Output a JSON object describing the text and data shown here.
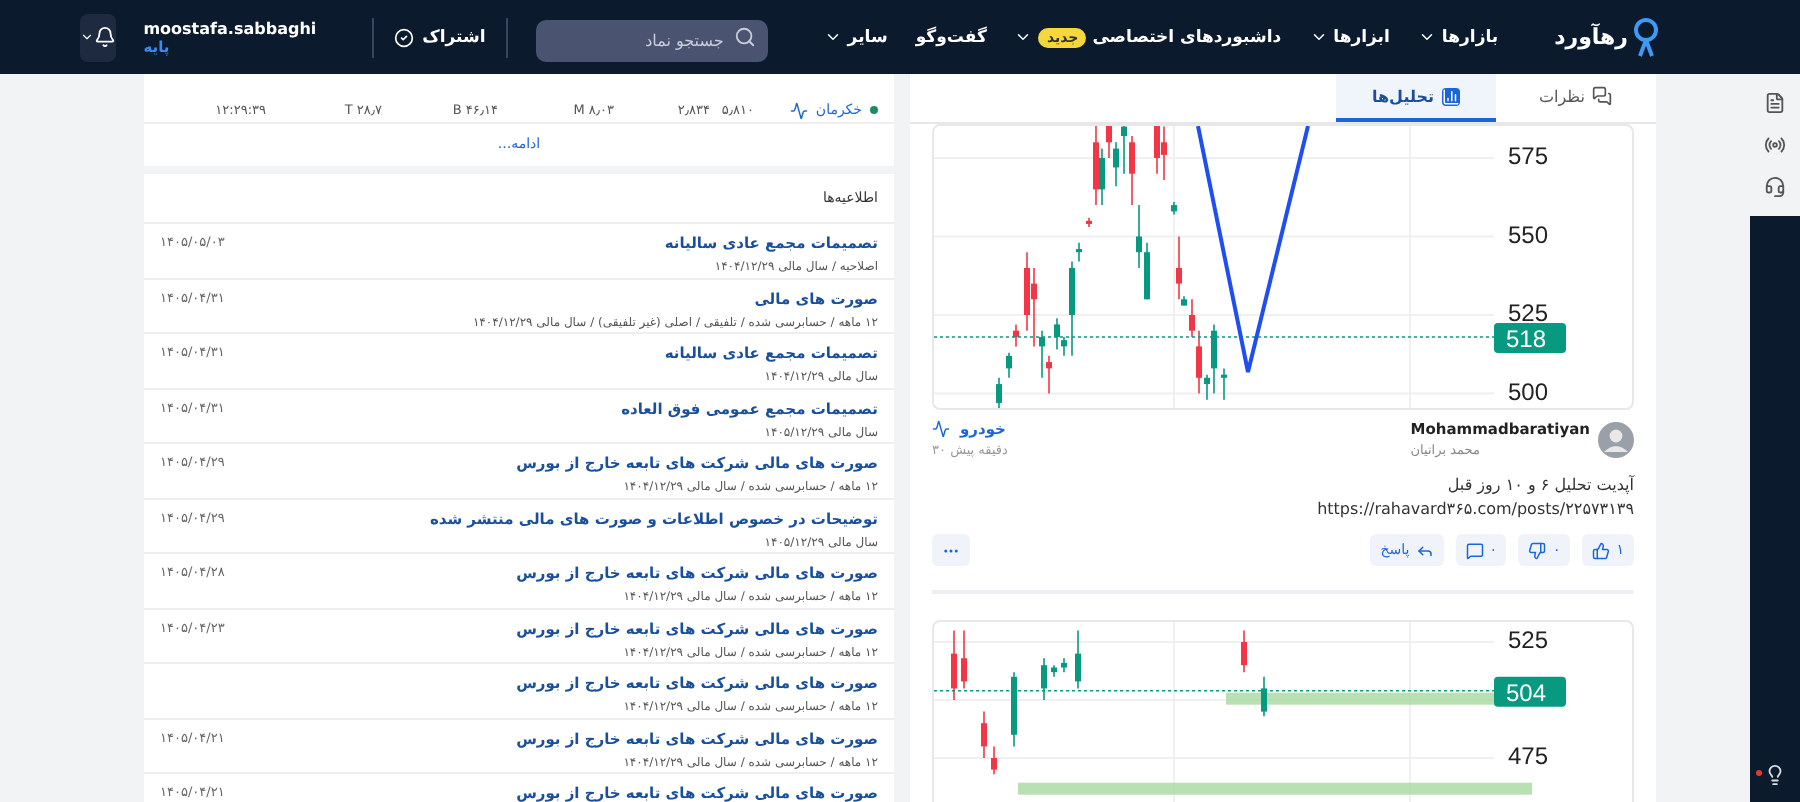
{
  "nav": {
    "logo": "رهآورد",
    "menu": [
      {
        "label": "بازارها",
        "dropdown": true
      },
      {
        "label": "ابزارها",
        "dropdown": true
      },
      {
        "label": "داشبوردهای اختصاصی",
        "badge": "جدید",
        "dropdown": true
      },
      {
        "label": "گفت‌وگو",
        "dropdown": false
      },
      {
        "label": "سایر",
        "dropdown": true
      }
    ],
    "search": {
      "placeholder": "جستجو نماد"
    },
    "subscription": "اشتراک",
    "user": {
      "name": "moostafa.sabbaghi",
      "plan": "پایه"
    }
  },
  "market_row": {
    "symbol": "خکرمان",
    "cells": [
      "۵٫۸۱۰",
      "۲٫۸۳۴",
      "۸٫۰۳ M",
      "۴۶٫۱۴ B",
      "۲۸٫۷ T",
      "۱۲:۲۹:۳۹"
    ]
  },
  "more_link": "ادامه...",
  "announcements": {
    "title": "اطلاعیه‌ها",
    "items": [
      {
        "title": "تصمیمات مجمع عادی سالیانه",
        "details": "اصلاحیه / سال مالی ۱۴۰۴/۱۲/۲۹",
        "date": "۱۴۰۵/۰۵/۰۳"
      },
      {
        "title": "صورت های مالی",
        "details": "۱۲ ماهه / حسابرسی شده / تلفیقی / اصلی (غیر تلفیقی) / سال مالی ۱۴۰۴/۱۲/۲۹",
        "date": "۱۴۰۵/۰۴/۳۱"
      },
      {
        "title": "تصمیمات مجمع عادی سالیانه",
        "details": "سال مالی ۱۴۰۴/۱۲/۲۹",
        "date": "۱۴۰۵/۰۴/۳۱"
      },
      {
        "title": "تصمیمات مجمع عمومی فوق العاده",
        "details": "سال مالی ۱۴۰۵/۱۲/۲۹",
        "date": "۱۴۰۵/۰۴/۳۱"
      },
      {
        "title": "صورت های مالی شرکت های تابعه خارج از بورس",
        "details": "۱۲ ماهه / حسابرسی شده / سال مالی ۱۴۰۴/۱۲/۲۹",
        "date": "۱۴۰۵/۰۴/۲۹"
      },
      {
        "title": "توضیحات در خصوص اطلاعات و صورت های مالی منتشر شده",
        "details": "سال مالی ۱۴۰۵/۱۲/۲۹",
        "date": "۱۴۰۵/۰۴/۲۹"
      },
      {
        "title": "صورت های مالی شرکت های تابعه خارج از بورس",
        "details": "۱۲ ماهه / حسابرسی شده / سال مالی ۱۴۰۴/۱۲/۲۹",
        "date": "۱۴۰۵/۰۴/۲۸"
      },
      {
        "title": "صورت های مالی شرکت های تابعه خارج از بورس",
        "details": "۱۲ ماهه / حسابرسی شده / سال مالی ۱۴۰۴/۱۲/۲۹",
        "date": "۱۴۰۵/۰۴/۲۳"
      },
      {
        "title": "صورت های مالی شرکت های تابعه خارج از بورس",
        "details": "۱۲ ماهه / حسابرسی شده / سال مالی ۱۴۰۴/۱۲/۲۹"
      },
      {
        "title": "صورت های مالی شرکت های تابعه خارج از بورس",
        "details": "۱۲ ماهه / حسابرسی شده / سال مالی ۱۴۰۴/۱۲/۲۹",
        "date": "۱۴۰۵/۰۴/۲۱"
      },
      {
        "title": "صورت های مالی شرکت های تابعه خارج از بورس",
        "date": "۱۴۰۵/۰۴/۲۱"
      }
    ]
  },
  "feed": {
    "tabs": [
      {
        "label": "نظرات",
        "selected": false
      },
      {
        "label": "تحلیل‌ها",
        "selected": true
      }
    ],
    "posts": [
      {
        "chart": {
          "price_ticks": [
            "575",
            "550",
            "525",
            "500"
          ],
          "last_price": "518"
        },
        "author": "Mohammadbaratiyan",
        "author_fa": "محمد براتیان",
        "symbol": "خودرو",
        "time": "۳۰ دقیقه پیش",
        "text": [
          "آپدیت تحلیل ۶ و ۱۰ روز قبل",
          "https://rahavard۳۶۵.com/posts/۲۲۵۷۳۱۳۹"
        ],
        "actions": {
          "likes": "۱",
          "dislikes": "۰",
          "comments": "۰",
          "reply": "پاسخ"
        }
      },
      {
        "chart": {
          "price_ticks": [
            "525",
            "475"
          ],
          "last_price": "504"
        }
      }
    ]
  }
}
